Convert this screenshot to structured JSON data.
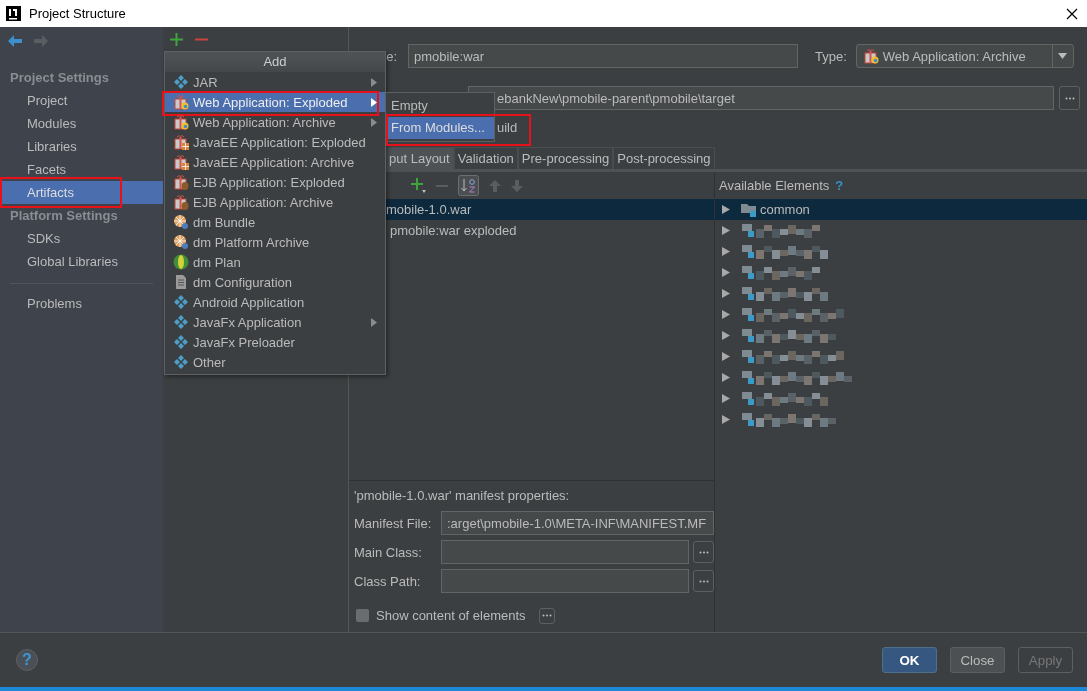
{
  "window": {
    "title": "Project Structure"
  },
  "sidebar": {
    "sections": [
      {
        "header": "Project Settings",
        "items": [
          {
            "label": "Project",
            "selected": false,
            "annotated": false
          },
          {
            "label": "Modules",
            "selected": false,
            "annotated": false
          },
          {
            "label": "Libraries",
            "selected": false,
            "annotated": false
          },
          {
            "label": "Facets",
            "selected": false,
            "annotated": false
          },
          {
            "label": "Artifacts",
            "selected": true,
            "annotated": true
          }
        ]
      },
      {
        "header": "Platform Settings",
        "items": [
          {
            "label": "SDKs",
            "selected": false,
            "annotated": false
          },
          {
            "label": "Global Libraries",
            "selected": false,
            "annotated": false
          }
        ]
      }
    ],
    "extra_items": [
      {
        "label": "Problems",
        "selected": false,
        "annotated": false
      }
    ]
  },
  "add_menu": {
    "title": "Add",
    "items": [
      {
        "label": "JAR",
        "kind": "module",
        "submenu": true,
        "selected": false,
        "annotated": false
      },
      {
        "label": "Web Application: Exploded",
        "kind": "web",
        "submenu": true,
        "selected": true,
        "annotated": true
      },
      {
        "label": "Web Application: Archive",
        "kind": "web",
        "submenu": true,
        "selected": false,
        "annotated": false
      },
      {
        "label": "JavaEE Application: Exploded",
        "kind": "javaee",
        "submenu": false,
        "selected": false,
        "annotated": false
      },
      {
        "label": "JavaEE Application: Archive",
        "kind": "javaee",
        "submenu": false,
        "selected": false,
        "annotated": false
      },
      {
        "label": "EJB Application: Exploded",
        "kind": "ejb",
        "submenu": false,
        "selected": false,
        "annotated": false
      },
      {
        "label": "EJB Application: Archive",
        "kind": "ejb",
        "submenu": false,
        "selected": false,
        "annotated": false
      },
      {
        "label": "dm Bundle",
        "kind": "bundle",
        "submenu": false,
        "selected": false,
        "annotated": false
      },
      {
        "label": "dm Platform Archive",
        "kind": "bundle",
        "submenu": false,
        "selected": false,
        "annotated": false
      },
      {
        "label": "dm Plan",
        "kind": "plan",
        "submenu": false,
        "selected": false,
        "annotated": false
      },
      {
        "label": "dm Configuration",
        "kind": "config",
        "submenu": false,
        "selected": false,
        "annotated": false
      },
      {
        "label": "Android Application",
        "kind": "module",
        "submenu": false,
        "selected": false,
        "annotated": false
      },
      {
        "label": "JavaFx Application",
        "kind": "module",
        "submenu": true,
        "selected": false,
        "annotated": false
      },
      {
        "label": "JavaFx Preloader",
        "kind": "module",
        "submenu": false,
        "selected": false,
        "annotated": false
      },
      {
        "label": "Other",
        "kind": "module",
        "submenu": false,
        "selected": false,
        "annotated": false
      }
    ]
  },
  "submenu": {
    "items": [
      {
        "label": "Empty",
        "selected": false,
        "annotated": false
      },
      {
        "label": "From Modules...",
        "selected": true,
        "annotated": true
      }
    ]
  },
  "editor": {
    "name_label": "e:",
    "name_value": "pmobile:war",
    "type_label": "Type:",
    "type_value": "Web Application: Archive",
    "output_path": "ebankNew\\pmobile-parent\\pmobile\\target",
    "build_label": "uild",
    "tabs": [
      {
        "label": "put Layout",
        "selected": true
      },
      {
        "label": "Validation",
        "selected": false
      },
      {
        "label": "Pre-processing",
        "selected": false
      },
      {
        "label": "Post-processing",
        "selected": false
      }
    ],
    "layout_tree": [
      {
        "label": "mobile-1.0.war",
        "selected": true
      },
      {
        "label": "pmobile:war exploded",
        "selected": false
      }
    ],
    "available": {
      "title": "Available Elements",
      "help": "?",
      "rows": [
        {
          "kind": "folder",
          "label": "common",
          "selected": true
        },
        {
          "kind": "blurred",
          "selected": false
        },
        {
          "kind": "blurred",
          "selected": false
        },
        {
          "kind": "blurred",
          "selected": false
        },
        {
          "kind": "blurred",
          "selected": false
        },
        {
          "kind": "blurred",
          "selected": false
        },
        {
          "kind": "blurred",
          "selected": false
        },
        {
          "kind": "blurred",
          "selected": false
        },
        {
          "kind": "blurred",
          "selected": false
        },
        {
          "kind": "blurred",
          "selected": false
        },
        {
          "kind": "blurred",
          "selected": false
        }
      ]
    },
    "manifest": {
      "heading": "'pmobile-1.0.war' manifest properties:",
      "fields": [
        {
          "label": "Manifest File:",
          "value": ":arget\\pmobile-1.0\\META-INF\\MANIFEST.MF",
          "browse": false
        },
        {
          "label": "Main Class:",
          "browse": true
        },
        {
          "label": "Class Path:",
          "browse": true
        }
      ],
      "show_content": {
        "label": "Show content of elements",
        "checked": false
      }
    }
  },
  "footer": {
    "help": "?",
    "buttons": [
      {
        "label": "OK",
        "kind": "primary"
      },
      {
        "label": "Close",
        "kind": "normal"
      },
      {
        "label": "Apply",
        "kind": "disabled"
      }
    ]
  }
}
